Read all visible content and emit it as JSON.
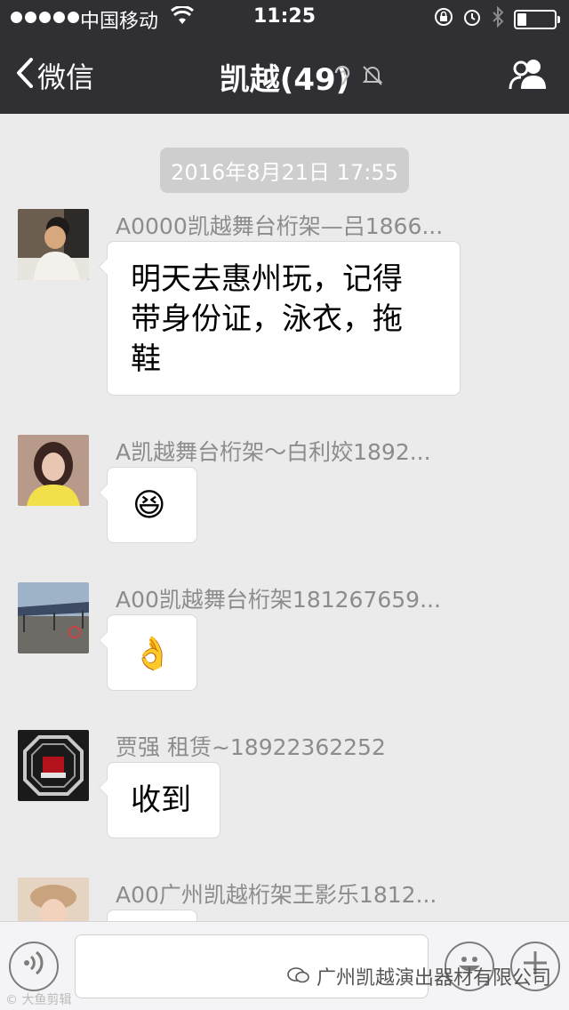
{
  "status_bar": {
    "carrier": "中国移动",
    "time": "11:25",
    "battery_level": 0.25
  },
  "nav": {
    "back_label": "微信",
    "title": "凯越(49)",
    "icons": [
      "earpiece-icon",
      "mute-icon"
    ],
    "right_icon": "group-members-icon"
  },
  "chat": {
    "timestamp": "2016年8月21日 17:55",
    "messages": [
      {
        "sender": "A0000凯越舞台桁架—吕1866...",
        "text": "明天去惠州玩，记得\n带身份证，泳衣，拖\n鞋",
        "type": "text"
      },
      {
        "sender": "A凯越舞台桁架～白利姣1892...",
        "text": "😆",
        "type": "emoji"
      },
      {
        "sender": "A00凯越舞台桁架181267659...",
        "text": "👌",
        "type": "emoji"
      },
      {
        "sender": "贾强   租赁~18922362252",
        "text": "收到",
        "type": "text"
      },
      {
        "sender": "A00广州凯越桁架王影乐1812...",
        "text": "",
        "type": "text"
      }
    ]
  },
  "input_bar": {
    "voice_icon": "voice-icon",
    "emoji_icon": "emoji-icon",
    "plus_icon": "plus-icon",
    "brand_text": "广州凯越演出器材有限公司",
    "watermark": "© 大鱼剪辑"
  },
  "colors": {
    "header_bg": "#2f2f34",
    "chat_bg": "#ebebeb",
    "bubble_bg": "#ffffff",
    "timestamp_bg": "#cecece"
  }
}
